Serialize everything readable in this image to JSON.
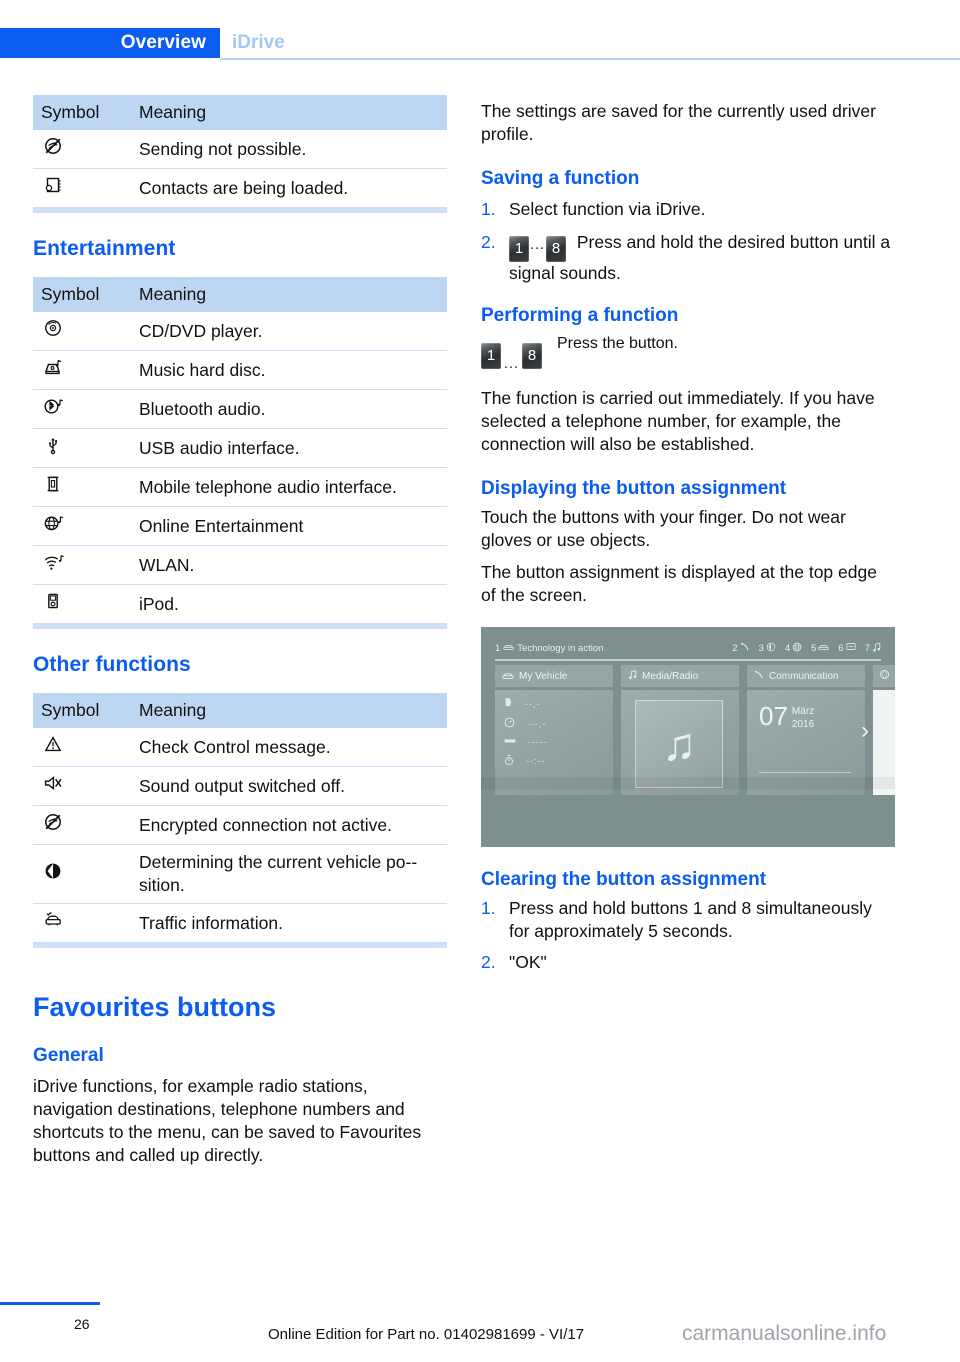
{
  "header": {
    "active_tab": "Overview",
    "inactive_tab": "iDrive",
    "accent_color": "#0b5cf0"
  },
  "left_column": {
    "table_telephone": {
      "columns": [
        "Symbol",
        "Meaning"
      ],
      "rows": [
        {
          "icon": "sending-not-possible-icon",
          "meaning": "Sending not possible."
        },
        {
          "icon": "contacts-loading-icon",
          "meaning": "Contacts are being loaded."
        }
      ]
    },
    "entertainment": {
      "heading": "Entertainment",
      "columns": [
        "Symbol",
        "Meaning"
      ],
      "rows": [
        {
          "icon": "cd-dvd-icon",
          "meaning": "CD/DVD player."
        },
        {
          "icon": "music-hard-disc-icon",
          "meaning": "Music hard disc."
        },
        {
          "icon": "bluetooth-audio-icon",
          "meaning": "Bluetooth audio."
        },
        {
          "icon": "usb-icon",
          "meaning": "USB audio interface."
        },
        {
          "icon": "mobile-phone-audio-icon",
          "meaning": "Mobile telephone audio interface."
        },
        {
          "icon": "online-entertainment-icon",
          "meaning": "Online Entertainment"
        },
        {
          "icon": "wlan-icon",
          "meaning": "WLAN."
        },
        {
          "icon": "ipod-icon",
          "meaning": "iPod."
        }
      ]
    },
    "other_functions": {
      "heading": "Other functions",
      "columns": [
        "Symbol",
        "Meaning"
      ],
      "rows": [
        {
          "icon": "warning-triangle-icon",
          "meaning": "Check Control message."
        },
        {
          "icon": "mute-speaker-icon",
          "meaning": "Sound output switched off."
        },
        {
          "icon": "encryption-off-icon",
          "meaning": "Encrypted connection not active."
        },
        {
          "icon": "compass-icon",
          "meaning": "Determining the current vehicle po-­sition."
        },
        {
          "icon": "traffic-info-icon",
          "meaning": "Traffic information."
        }
      ]
    },
    "favourites": {
      "title": "Favourites buttons",
      "general_heading": "General",
      "general_text": "iDrive functions, for example radio stations, navigation destinations, telephone numbers and shortcuts to the menu, can be saved to Favourites buttons and called up directly."
    }
  },
  "right_column": {
    "intro_text": "The settings are saved for the currently used driver profile.",
    "saving": {
      "heading": "Saving a function",
      "step1_num": "1.",
      "step1_text": "Select function via iDrive.",
      "step2_num": "2.",
      "step2_btn_first": "1",
      "step2_btn_dots": "…",
      "step2_btn_last": "8",
      "step2_text": "Press and hold the desired button until a signal sounds."
    },
    "performing": {
      "heading": "Performing a function",
      "btn_first": "1",
      "btn_dots": "…",
      "btn_last": "8",
      "action_text": "Press the button.",
      "body_text": "The function is carried out immediately. If you have selected a telephone number, for exam­ple, the connection will also be established."
    },
    "displaying": {
      "heading": "Displaying the button assignment",
      "p1": "Touch the buttons with your finger. Do not wear gloves or use objects.",
      "p2": "The button assignment is displayed at the top edge of the screen."
    },
    "idrive_screen": {
      "fav_1_num": "1",
      "fav_1_icon": "car-icon",
      "fav_1_label": "Technology in action",
      "fav_slots": [
        {
          "num": "2",
          "icon": "phone-handset-icon"
        },
        {
          "num": "3",
          "icon": "navigation-arrow-icon"
        },
        {
          "num": "4",
          "icon": "globe-icon"
        },
        {
          "num": "5",
          "icon": "car-icon"
        },
        {
          "num": "6",
          "icon": "message-icon"
        },
        {
          "num": "7",
          "icon": "music-note-icon"
        }
      ],
      "tiles": [
        {
          "icon": "car-icon",
          "label": "My Vehicle"
        },
        {
          "icon": "music-note-icon",
          "label": "Media/Radio"
        },
        {
          "icon": "phone-handset-icon",
          "label": "Communication"
        }
      ],
      "vehicle_rows": [
        {
          "icon": "fuel-icon",
          "value": "--,-"
        },
        {
          "icon": "gauge-icon",
          "value": "---,-"
        },
        {
          "icon": "odometer-icon",
          "value": "-----"
        },
        {
          "icon": "stopwatch-icon",
          "value": "--:--"
        }
      ],
      "media_icon": "music-note-icon",
      "date_day": "07",
      "date_month": "März",
      "date_year": "2016",
      "chevron": "›"
    },
    "clearing": {
      "heading": "Clearing the button assignment",
      "step1_num": "1.",
      "step1_text": "Press and hold buttons 1 and 8 simultane­ously for approximately 5 seconds.",
      "step2_num": "2.",
      "step2_text": "\"OK\""
    }
  },
  "footer": {
    "page_number": "26",
    "edition_text": "Online Edition for Part no. 01402981699 - VI/17",
    "watermark": "carmanualsonline.info"
  }
}
